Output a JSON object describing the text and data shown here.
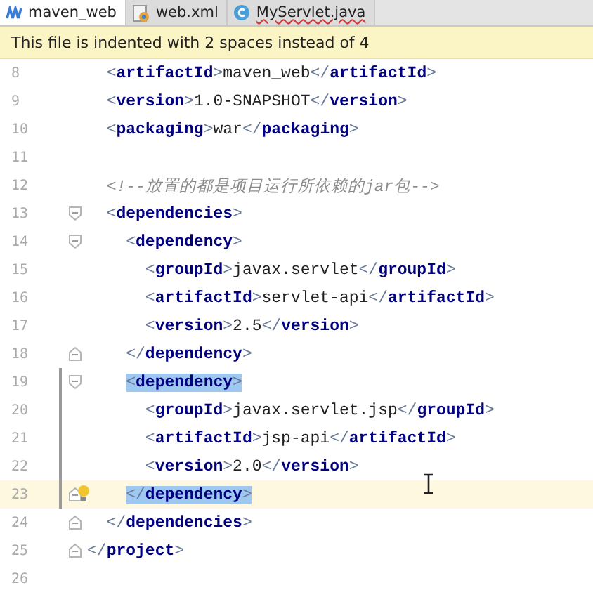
{
  "tabs": [
    {
      "label": "maven_web",
      "kind": "maven",
      "selected": true,
      "error": false
    },
    {
      "label": "web.xml",
      "kind": "xml",
      "selected": false,
      "error": false
    },
    {
      "label": "MyServlet.java",
      "kind": "class",
      "selected": false,
      "error": true
    }
  ],
  "banner": {
    "text": "This file is indented with 2 spaces instead of 4"
  },
  "editor": {
    "lines": [
      {
        "number": "8",
        "code": "  <artifactId>maven_web</artifactId>",
        "fold_start": false,
        "fold_end": false,
        "match": false,
        "bulb": false,
        "current": false,
        "changed": false
      },
      {
        "number": "9",
        "code": "  <version>1.0-SNAPSHOT</version>",
        "fold_start": false,
        "fold_end": false,
        "match": false,
        "bulb": false,
        "current": false,
        "changed": false
      },
      {
        "number": "10",
        "code": "  <packaging>war</packaging>",
        "fold_start": false,
        "fold_end": false,
        "match": false,
        "bulb": false,
        "current": false,
        "changed": false
      },
      {
        "number": "11",
        "fold_start": false,
        "fold_end": false,
        "bulb": false,
        "current": false,
        "changed": false
      },
      {
        "number": "12",
        "code": "  <!--放置的都是项目运行所依赖的jar包-->",
        "fold_start": false,
        "fold_end": false,
        "match": false,
        "bulb": false,
        "current": false,
        "changed": false
      },
      {
        "number": "13",
        "code": "  <dependencies>",
        "fold_start": true,
        "fold_end": false,
        "match": false,
        "bulb": false,
        "current": false,
        "changed": false
      },
      {
        "number": "14",
        "code": "    <dependency>",
        "fold_start": true,
        "fold_end": false,
        "match": false,
        "bulb": false,
        "current": false,
        "changed": false
      },
      {
        "number": "15",
        "code": "      <groupId>javax.servlet</groupId>",
        "fold_start": false,
        "fold_end": false,
        "match": false,
        "bulb": false,
        "current": false,
        "changed": false
      },
      {
        "number": "16",
        "code": "      <artifactId>servlet-api</artifactId>",
        "fold_start": false,
        "fold_end": false,
        "match": false,
        "bulb": false,
        "current": false,
        "changed": false
      },
      {
        "number": "17",
        "code": "      <version>2.5</version>",
        "fold_start": false,
        "fold_end": false,
        "match": false,
        "bulb": false,
        "current": false,
        "changed": false
      },
      {
        "number": "18",
        "code": "    </dependency>",
        "fold_start": false,
        "fold_end": true,
        "match": false,
        "bulb": false,
        "current": false,
        "changed": false
      },
      {
        "number": "19",
        "code": "    <dependency>",
        "fold_start": true,
        "fold_end": false,
        "match": true,
        "bulb": false,
        "current": false,
        "changed": true
      },
      {
        "number": "20",
        "code": "      <groupId>javax.servlet.jsp</groupId>",
        "fold_start": false,
        "fold_end": false,
        "match": false,
        "bulb": false,
        "current": false,
        "changed": true
      },
      {
        "number": "21",
        "code": "      <artifactId>jsp-api</artifactId>",
        "fold_start": false,
        "fold_end": false,
        "match": false,
        "bulb": false,
        "current": false,
        "changed": true
      },
      {
        "number": "22",
        "code": "      <version>2.0</version>",
        "fold_start": false,
        "fold_end": false,
        "match": false,
        "bulb": false,
        "current": false,
        "changed": true
      },
      {
        "number": "23",
        "code": "    </dependency>",
        "fold_start": false,
        "fold_end": true,
        "match": true,
        "bulb": true,
        "current": true,
        "changed": true
      },
      {
        "number": "24",
        "code": "  </dependencies>",
        "fold_start": false,
        "fold_end": true,
        "match": false,
        "bulb": false,
        "current": false,
        "changed": false
      },
      {
        "number": "25",
        "code": "</project>",
        "fold_start": false,
        "fold_end": true,
        "match": false,
        "bulb": false,
        "current": false,
        "changed": false
      },
      {
        "number": "26",
        "fold_start": false,
        "fold_end": false,
        "bulb": false,
        "current": false,
        "changed": false
      }
    ]
  }
}
